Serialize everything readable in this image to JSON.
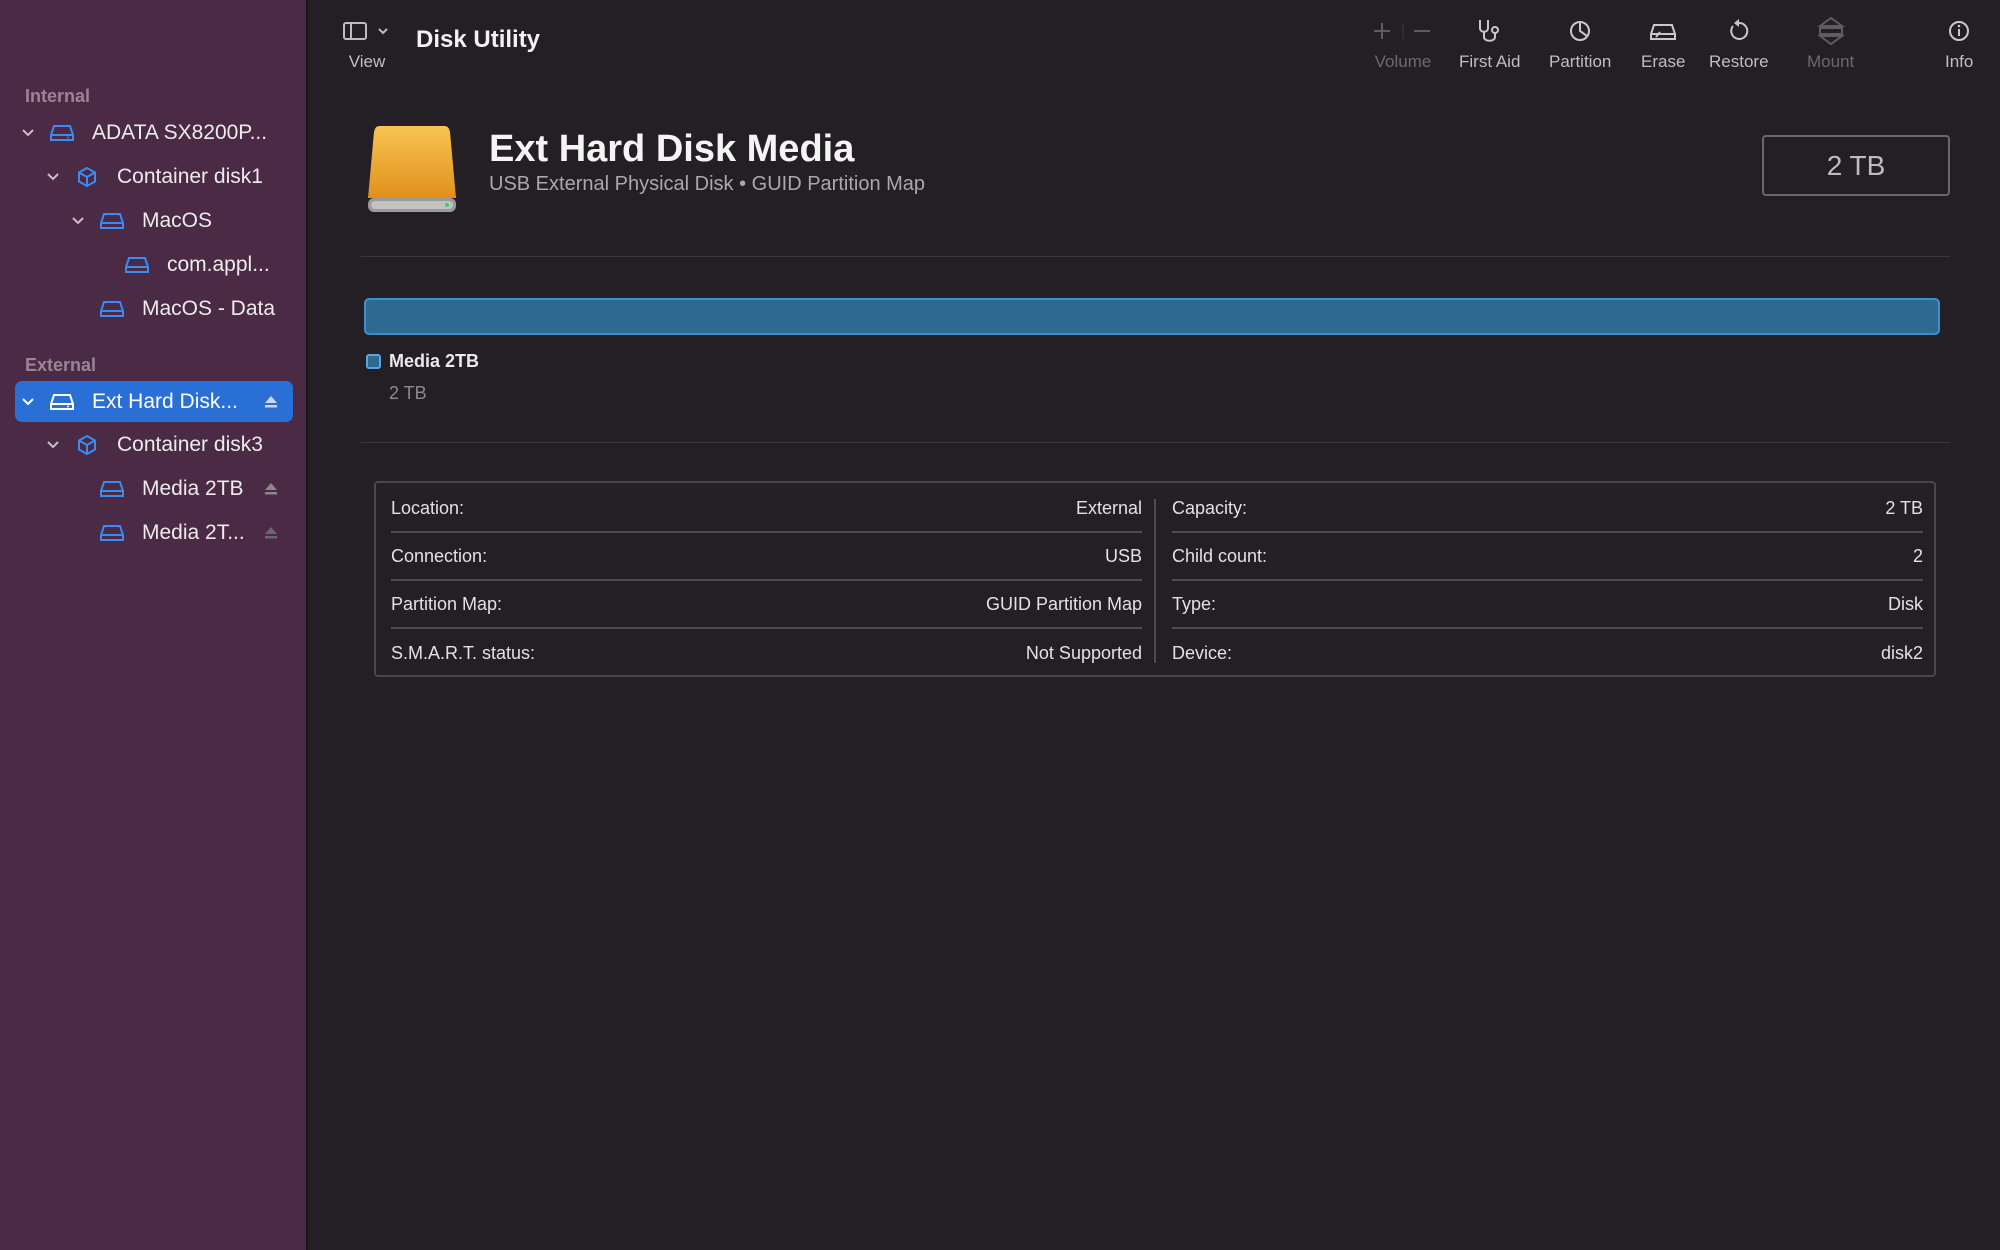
{
  "app": {
    "title": "Disk Utility"
  },
  "sidebar": {
    "section_internal": "Internal",
    "section_external": "External",
    "internal_items": [
      {
        "label": "ADATA SX8200P...",
        "icon": "drive-icon",
        "chevron": "chevron-down"
      },
      {
        "label": "Container disk1",
        "icon": "container-icon",
        "chevron": "chevron-down"
      },
      {
        "label": "MacOS",
        "icon": "volume-icon",
        "chevron": "chevron-down"
      },
      {
        "label": "com.appl...",
        "icon": "volume-icon"
      },
      {
        "label": "MacOS - Data",
        "icon": "volume-icon"
      }
    ],
    "external_items": [
      {
        "label": "Ext Hard Disk...",
        "icon": "drive-icon",
        "chevron": "chevron-down",
        "selected": true,
        "eject": true
      },
      {
        "label": "Container disk3",
        "icon": "container-icon",
        "chevron": "chevron-down"
      },
      {
        "label": "Media 2TB",
        "icon": "volume-icon",
        "eject": true
      },
      {
        "label": "Media 2T...",
        "icon": "volume-icon",
        "eject": true
      }
    ]
  },
  "toolbar": {
    "view_label": "View",
    "volume_label": "Volume",
    "first_aid_label": "First Aid",
    "partition_label": "Partition",
    "erase_label": "Erase",
    "restore_label": "Restore",
    "mount_label": "Mount",
    "info_label": "Info"
  },
  "disk": {
    "name": "Ext Hard Disk Media",
    "subtitle": "USB External Physical Disk • GUID Partition Map",
    "capacity": "2 TB",
    "usage_fraction": 1.0,
    "partition_name": "Media 2TB",
    "partition_size": "2 TB"
  },
  "info": {
    "left": [
      {
        "label": "Location:",
        "value": "External"
      },
      {
        "label": "Connection:",
        "value": "USB"
      },
      {
        "label": "Partition Map:",
        "value": "GUID Partition Map"
      },
      {
        "label": "S.M.A.R.T. status:",
        "value": "Not Supported"
      }
    ],
    "right": [
      {
        "label": "Capacity:",
        "value": "2 TB"
      },
      {
        "label": "Child count:",
        "value": "2"
      },
      {
        "label": "Type:",
        "value": "Disk"
      },
      {
        "label": "Device:",
        "value": "disk2"
      }
    ]
  },
  "colors": {
    "sidebar_bg": "#4a2a44",
    "main_bg": "#231f25",
    "selection": "#2a6fd6",
    "accent_icon": "#3a8cf0",
    "usage_bar": "#2d6a92",
    "drive_icon": "#f0a92a"
  }
}
